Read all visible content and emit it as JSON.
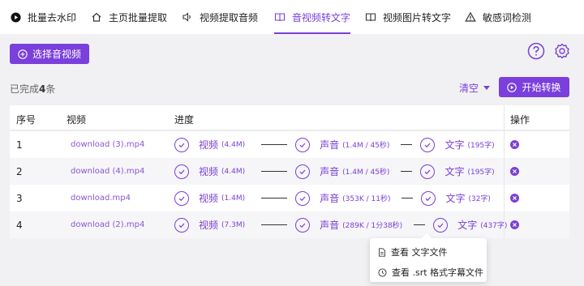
{
  "nav": {
    "tabs": [
      {
        "label": "批量去水印",
        "icon": "play-circle-icon"
      },
      {
        "label": "主页批量提取",
        "icon": "home-icon"
      },
      {
        "label": "视频提取音频",
        "icon": "speaker-icon"
      },
      {
        "label": "音视频转文字",
        "icon": "book-icon",
        "active": true
      },
      {
        "label": "视频图片转文字",
        "icon": "book-open-icon"
      },
      {
        "label": "敏感词检测",
        "icon": "warning-icon"
      }
    ]
  },
  "toolbar": {
    "select_label": "选择音视频",
    "help_icon": "help-circle-icon",
    "settings_icon": "gear-icon"
  },
  "status": {
    "prefix": "已完成",
    "count": "4",
    "suffix": "条"
  },
  "actions": {
    "clear_label": "清空",
    "start_label": "开始转换"
  },
  "table": {
    "headers": {
      "index": "序号",
      "video": "视频",
      "progress": "进度",
      "action": "操作"
    },
    "rows": [
      {
        "index": "1",
        "file": "download (3).mp4",
        "video_label": "视频",
        "video_meta": "(4.4M)",
        "audio_label": "声音",
        "audio_meta": "(1.4M / 45秒)",
        "text_label": "文字",
        "text_meta": "(195字)"
      },
      {
        "index": "2",
        "file": "download (4).mp4",
        "video_label": "视频",
        "video_meta": "(4.4M)",
        "audio_label": "声音",
        "audio_meta": "(1.4M / 45秒)",
        "text_label": "文字",
        "text_meta": "(195字)"
      },
      {
        "index": "3",
        "file": "download.mp4",
        "video_label": "视频",
        "video_meta": "(1.4M)",
        "audio_label": "声音",
        "audio_meta": "(353K / 11秒)",
        "text_label": "文字",
        "text_meta": "(32字)"
      },
      {
        "index": "4",
        "file": "download (2).mp4",
        "video_label": "视频",
        "video_meta": "(7.3M)",
        "audio_label": "声音",
        "audio_meta": "(289K / 1分38秒)",
        "text_label": "文字",
        "text_meta": "(437字)"
      }
    ]
  },
  "popup": {
    "items": [
      {
        "label": "查看 文字文件",
        "icon": "file-icon"
      },
      {
        "label": "查看 .srt 格式字幕文件",
        "icon": "clock-icon"
      }
    ]
  },
  "colors": {
    "accent": "#7a3fd6",
    "background": "#f1f1f3"
  }
}
